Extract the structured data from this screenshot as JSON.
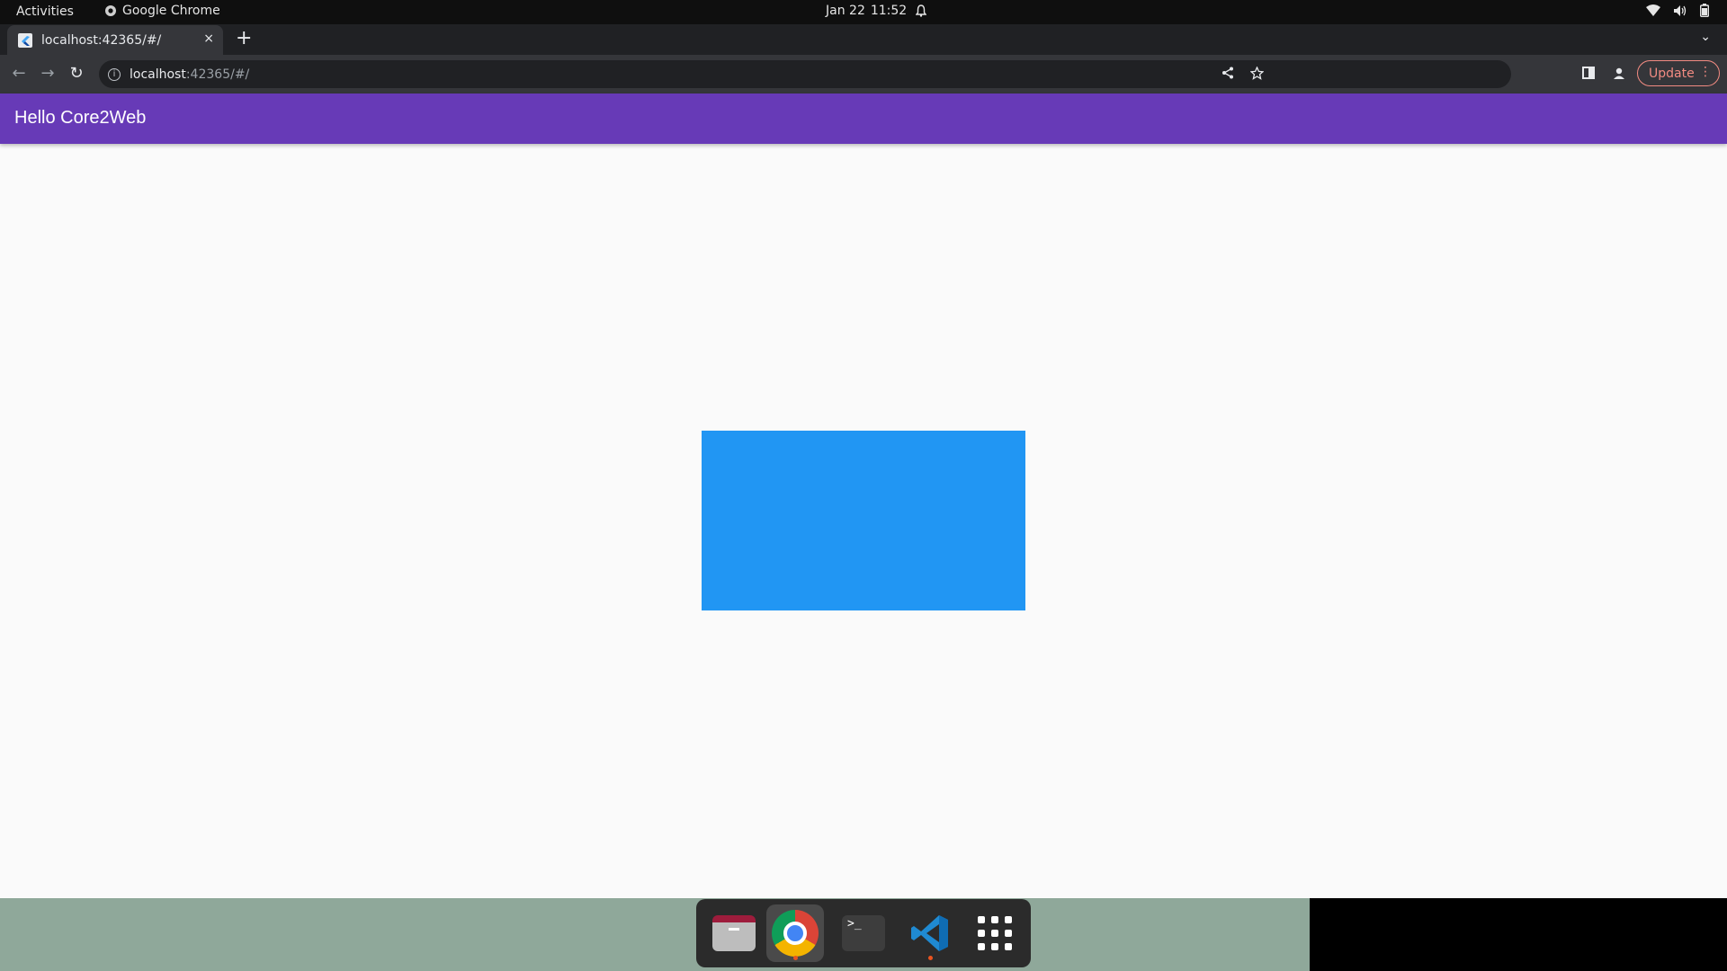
{
  "system_bar": {
    "activities": "Activities",
    "app_name": "Google Chrome",
    "date": "Jan 22",
    "time": "11:52"
  },
  "browser": {
    "tab": {
      "title": "localhost:42365/#/",
      "close": "×"
    },
    "new_tab": "+",
    "url_host": "localhost",
    "url_rest": ":42365/#/",
    "update_label": "Update"
  },
  "app": {
    "title": "Hello Core2Web",
    "appbar_color": "#673ab7",
    "box_color": "#2196f3"
  },
  "dock": {
    "items": [
      "files-icon",
      "chrome-icon",
      "terminal-icon",
      "vscode-icon",
      "show-apps-icon"
    ],
    "terminal_glyph": ">_"
  }
}
